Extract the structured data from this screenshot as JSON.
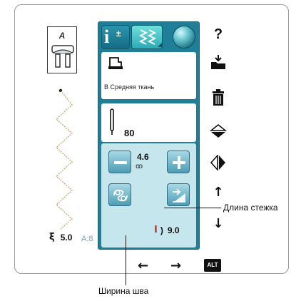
{
  "left_panel": {
    "presser_foot_letter": "A",
    "stitch_code": "A:8"
  },
  "tabs": {
    "info_glyph": "i",
    "info_sign": "±"
  },
  "fabric": {
    "icon": "fabric-icon",
    "label": "В Средняя ткань"
  },
  "needle": {
    "icon": "needle-icon",
    "size": "80"
  },
  "stitch_density": {
    "value": "4.6",
    "icon": "ꝏ"
  },
  "stitch_length": {
    "value": "9.0",
    "icon_glyph": "Ӏ",
    "paren": ")"
  },
  "stitch_width": {
    "value": "5.0",
    "icon_glyph": "ξ"
  },
  "toolbar": {
    "help": "?",
    "up": "↑",
    "down": "↓",
    "alt": "ALT"
  },
  "nav": {
    "left": "←",
    "right": "→"
  },
  "callouts": {
    "length_label": "Длина стежка",
    "width_label": "Ширина шва"
  },
  "colors": {
    "panel": "#1f7f99",
    "accent": "#6fe0dc",
    "length_icon": "#c23030"
  }
}
